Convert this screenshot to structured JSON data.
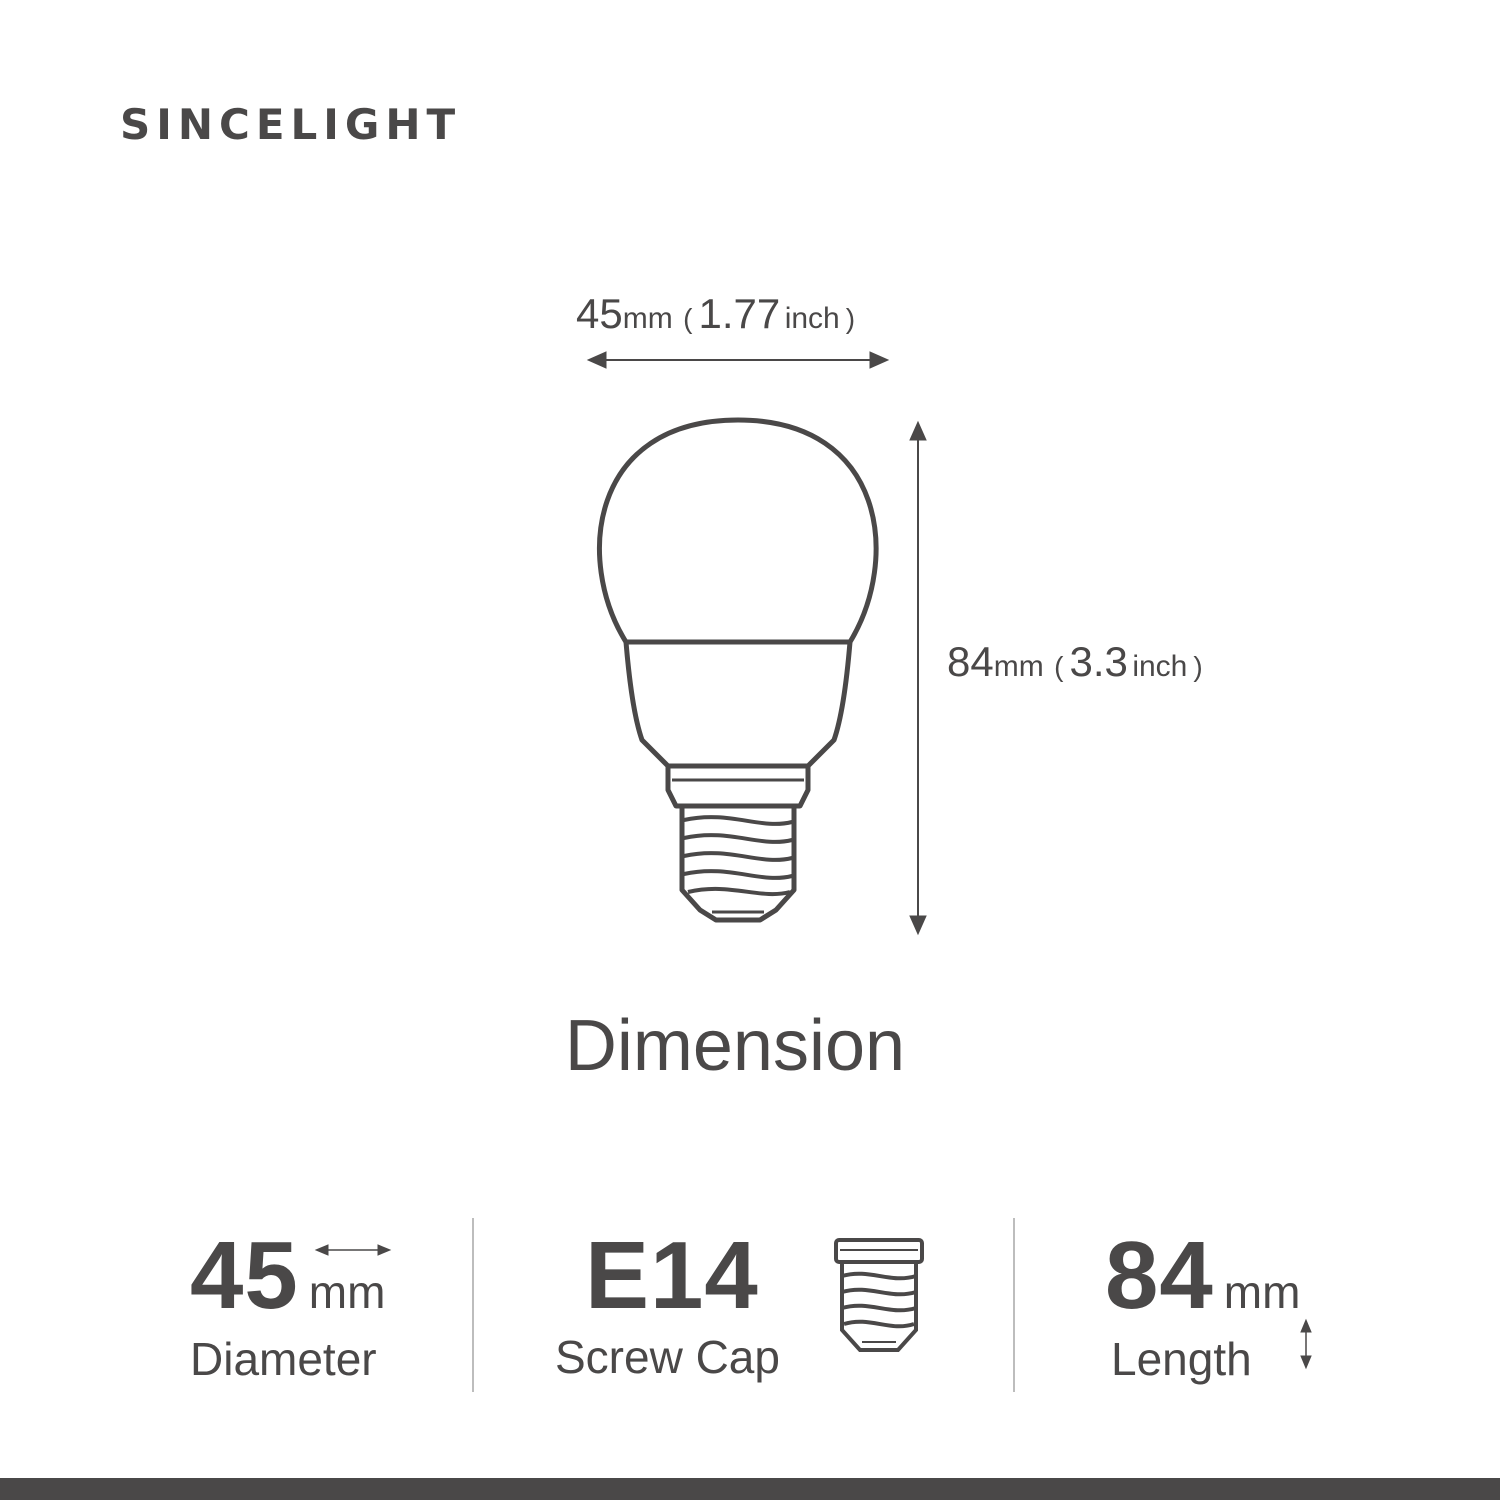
{
  "brand": "SINCELIGHT",
  "title": "Dimension",
  "width_dimension": {
    "value": "45",
    "unit": "mm",
    "open": "(",
    "inch_value": "1.77",
    "inch_unit": "inch",
    "close": ")"
  },
  "height_dimension": {
    "value": "84",
    "unit": "mm",
    "open": "(",
    "inch_value": "3.3",
    "inch_unit": "inch",
    "close": ")"
  },
  "specs": {
    "diameter": {
      "value": "45",
      "unit": "mm",
      "caption": "Diameter"
    },
    "cap": {
      "value": "E14",
      "caption": "Screw Cap"
    },
    "length": {
      "value": "84",
      "unit": "mm",
      "caption": "Length"
    }
  },
  "colors": {
    "ink": "#4a4848",
    "divider": "#bdbdbd",
    "background": "#ffffff"
  },
  "icons": [
    "bulb-outline-icon",
    "width-arrow-icon",
    "height-arrow-icon",
    "screw-cap-icon"
  ]
}
